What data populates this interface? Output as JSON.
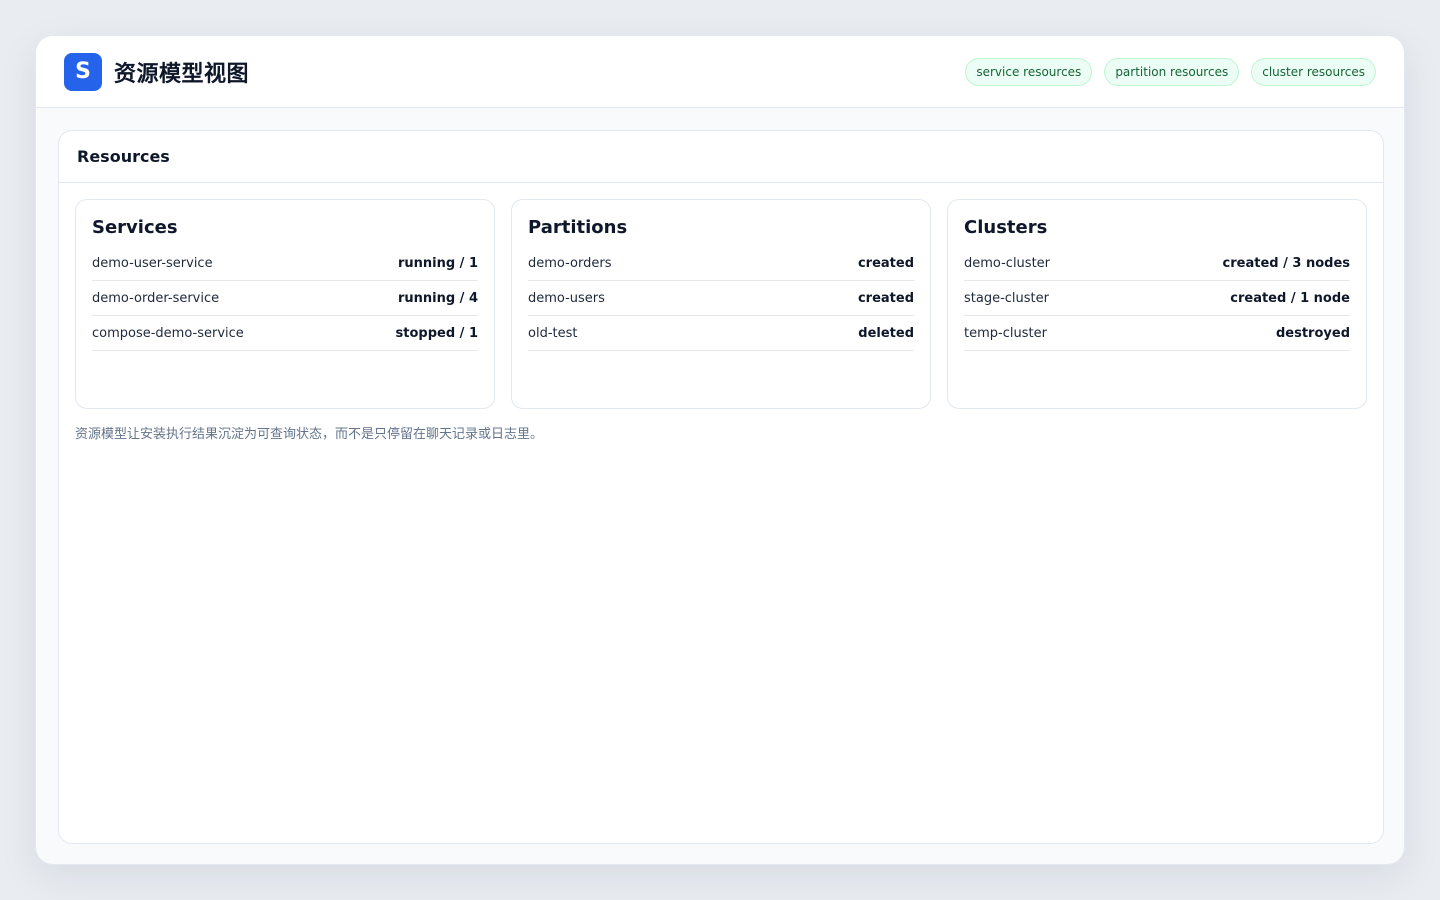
{
  "header": {
    "logo_letter": "S",
    "title": "资源模型视图",
    "tags": [
      "service resources",
      "partition resources",
      "cluster resources"
    ]
  },
  "panel": {
    "title": "Resources",
    "cards": [
      {
        "title": "Services",
        "rows": [
          {
            "name": "demo-user-service",
            "status": "running / 1"
          },
          {
            "name": "demo-order-service",
            "status": "running / 4"
          },
          {
            "name": "compose-demo-service",
            "status": "stopped / 1"
          }
        ]
      },
      {
        "title": "Partitions",
        "rows": [
          {
            "name": "demo-orders",
            "status": "created"
          },
          {
            "name": "demo-users",
            "status": "created"
          },
          {
            "name": "old-test",
            "status": "deleted"
          }
        ]
      },
      {
        "title": "Clusters",
        "rows": [
          {
            "name": "demo-cluster",
            "status": "created / 3 nodes"
          },
          {
            "name": "stage-cluster",
            "status": "created / 1 node"
          },
          {
            "name": "temp-cluster",
            "status": "destroyed"
          }
        ]
      }
    ],
    "footnote": "资源模型让安装执行结果沉淀为可查询状态，而不是只停留在聊天记录或日志里。"
  },
  "colors": {
    "accent": "#2563eb",
    "tag_bg": "#ecfdf5",
    "tag_text": "#166534"
  }
}
